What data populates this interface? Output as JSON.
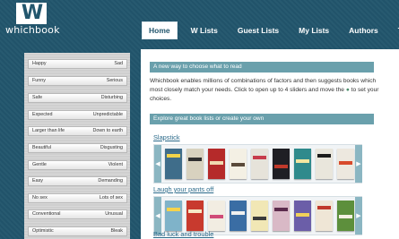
{
  "brand": {
    "mark": "W",
    "name": "whichbook"
  },
  "nav": {
    "tabs": [
      {
        "label": "Home",
        "active": true
      },
      {
        "label": "W Lists",
        "active": false
      },
      {
        "label": "Guest Lists",
        "active": false
      },
      {
        "label": "My Lists",
        "active": false
      },
      {
        "label": "Authors",
        "active": false
      },
      {
        "label": "Titles",
        "active": false
      }
    ]
  },
  "sliders": [
    {
      "left": "Happy",
      "right": "Sad"
    },
    {
      "left": "Funny",
      "right": "Serious"
    },
    {
      "left": "Safe",
      "right": "Disturbing"
    },
    {
      "left": "Expected",
      "right": "Unpredictable"
    },
    {
      "left": "Larger than life",
      "right": "Down to earth"
    },
    {
      "left": "Beautiful",
      "right": "Disgusting"
    },
    {
      "left": "Gentle",
      "right": "Violent"
    },
    {
      "left": "Easy",
      "right": "Demanding"
    },
    {
      "left": "No sex",
      "right": "Lots of sex"
    },
    {
      "left": "Conventional",
      "right": "Unusual"
    },
    {
      "left": "Optimistic",
      "right": "Bleak"
    }
  ],
  "main": {
    "intro_bar": "A new way to choose what to read",
    "intro_text_1": "Whichbook enables millions of combinations of factors and then suggests books which most closely match your needs. Click to open up to 4 sliders and move the",
    "intro_text_2": "to set your choices.",
    "leaf_icon": "leaf-icon",
    "explore_bar": "Explore great book lists or create your own",
    "lists": [
      {
        "title": "Slapstick"
      },
      {
        "title": "Laugh your pants off"
      },
      {
        "title": "Bad luck and trouble"
      }
    ]
  },
  "colors": {
    "background": "#22566d",
    "bar": "#6aa0ac",
    "link": "#2b6a8a"
  }
}
